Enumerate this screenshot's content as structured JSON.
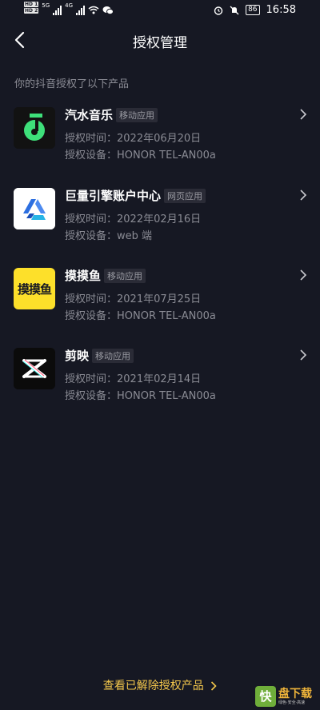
{
  "status_bar": {
    "hd1": "HD 1",
    "hd2": "HD 2",
    "net1": "5G",
    "net2": "4G",
    "battery": "86",
    "time": "16:58"
  },
  "header": {
    "title": "授权管理"
  },
  "section_label": "你的抖音授权了以下产品",
  "labels": {
    "time": "授权时间：",
    "device": "授权设备："
  },
  "apps": [
    {
      "name": "汽水音乐",
      "tag": "移动应用",
      "time": "2022年06月20日",
      "device": "HONOR TEL-AN00a",
      "icon": "qishui-music-icon"
    },
    {
      "name": "巨量引擎账户中心",
      "tag": "网页应用",
      "time": "2022年02月16日",
      "device": "web 端",
      "icon": "ocean-engine-icon"
    },
    {
      "name": "摸摸鱼",
      "tag": "移动应用",
      "time": "2021年07月25日",
      "device": "HONOR TEL-AN00a",
      "icon": "momoyu-icon",
      "icon_text": "摸摸鱼"
    },
    {
      "name": "剪映",
      "tag": "移动应用",
      "time": "2021年02月14日",
      "device": "HONOR TEL-AN00a",
      "icon": "capcut-icon"
    }
  ],
  "footer": {
    "link": "查看已解除授权产品"
  },
  "watermark": {
    "mark": "快",
    "text": "盘下载",
    "sub": "绿色·安全·高速"
  },
  "colors": {
    "background": "#161823",
    "accent": "#f5c84c",
    "muted": "#8a8b94"
  }
}
